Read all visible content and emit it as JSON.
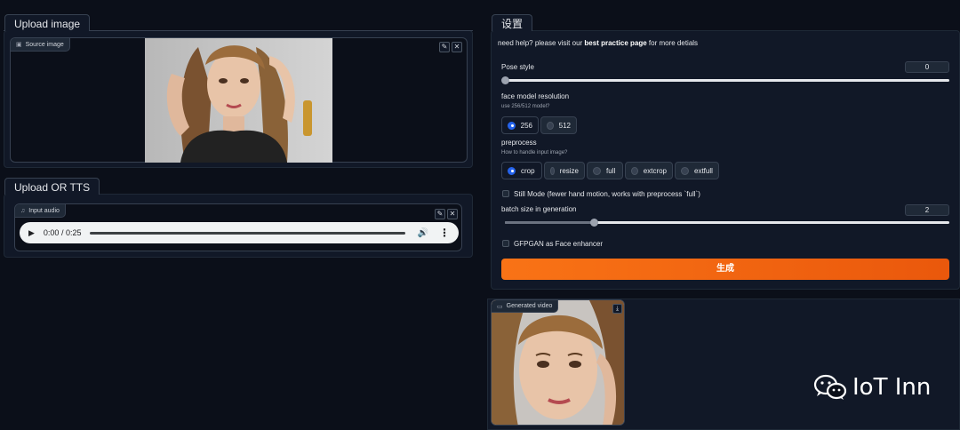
{
  "left": {
    "upload_tab": "Upload image",
    "source_image_label": "Source image",
    "source_image_icon": "image-icon",
    "audio_tab": "Upload OR TTS",
    "input_audio_label": "Input audio",
    "input_audio_icon": "music-icon",
    "audio_time": "0:00 / 0:25"
  },
  "right": {
    "settings_tab": "设置",
    "help_prefix": "need help? please visit our",
    "help_link": "best practice page",
    "help_suffix": "for more detials",
    "pose_style_label": "Pose style",
    "pose_style_value": "0",
    "pose_style_fraction": 0.0,
    "face_model_label": "face model resolution",
    "face_model_hint": "use 256/512 model?",
    "face_model_options": [
      "256",
      "512"
    ],
    "face_model_selected": "256",
    "preprocess_label": "preprocess",
    "preprocess_hint": "How to handle input image?",
    "preprocess_options": [
      "crop",
      "resize",
      "full",
      "extcrop",
      "extfull"
    ],
    "preprocess_selected": "crop",
    "still_mode_label": "Still Mode (fewer hand motion, works with preprocess `full`)",
    "batch_size_label": "batch size in generation",
    "batch_size_value": "2",
    "batch_size_fraction": 0.2,
    "gfpgan_label": "GFPGAN as Face enhancer",
    "generate_button": "生成",
    "generated_video_label": "Generated video",
    "generated_video_icon": "video-icon"
  },
  "watermark": {
    "text": "IoT Inn",
    "icon": "wechat-icon"
  },
  "colors": {
    "accent": "#f97316",
    "selected": "#2563eb",
    "background": "#0b0f19",
    "panel": "#111827"
  }
}
